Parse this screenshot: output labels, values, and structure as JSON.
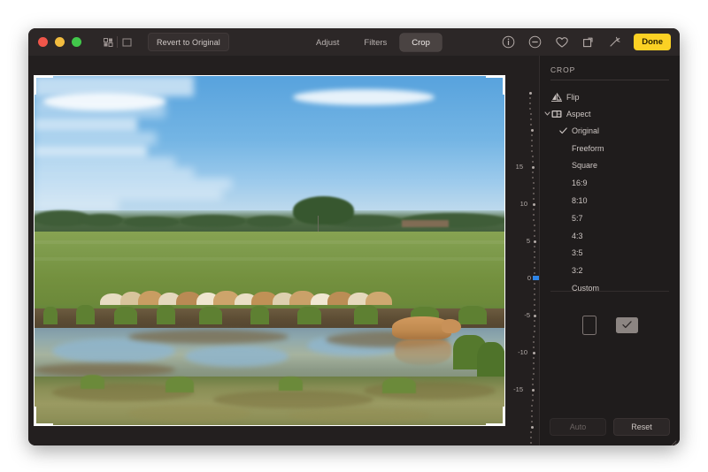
{
  "window": {
    "traffic_lights": [
      {
        "name": "close",
        "color": "#f0564a"
      },
      {
        "name": "minimize",
        "color": "#f2bc3f"
      },
      {
        "name": "zoom",
        "color": "#42c84b"
      }
    ],
    "revert_label": "Revert to Original"
  },
  "toolbar": {
    "segments": [
      {
        "label": "Adjust",
        "active": false
      },
      {
        "label": "Filters",
        "active": false
      },
      {
        "label": "Crop",
        "active": true
      }
    ],
    "icons": [
      {
        "name": "info-icon",
        "glyph": "i"
      },
      {
        "name": "minus-circle-icon",
        "glyph": "-"
      },
      {
        "name": "heart-icon",
        "glyph": "heart"
      },
      {
        "name": "rotate-icon",
        "glyph": "rotate"
      },
      {
        "name": "magic-wand-icon",
        "glyph": "wand"
      }
    ],
    "done_label": "Done"
  },
  "panel": {
    "title": "CROP",
    "flip_label": "Flip",
    "aspect_label": "Aspect",
    "aspect_options": [
      {
        "label": "Original",
        "selected": true
      },
      {
        "label": "Freeform",
        "selected": false
      },
      {
        "label": "Square",
        "selected": false
      },
      {
        "label": "16:9",
        "selected": false
      },
      {
        "label": "8:10",
        "selected": false
      },
      {
        "label": "5:7",
        "selected": false
      },
      {
        "label": "4:3",
        "selected": false
      },
      {
        "label": "3:5",
        "selected": false
      },
      {
        "label": "3:2",
        "selected": false
      },
      {
        "label": "Custom",
        "selected": false
      }
    ],
    "orientation": {
      "portrait_name": "portrait-orientation",
      "landscape_name": "landscape-orientation",
      "selected": "landscape"
    },
    "auto_label": "Auto",
    "auto_enabled": false,
    "reset_label": "Reset"
  },
  "dial": {
    "labels": [
      "15",
      "10",
      "5",
      "0",
      "-5",
      "-10",
      "-15"
    ],
    "current_value": "0",
    "marker_color": "#2e85e8"
  },
  "photo": {
    "alt": "Herd of cream and tan cattle grazing beside a muddy pond in a green summer field under a blue sky with scattered clouds; one cow stands in the water with its reflection.",
    "accent_crop_handle_color": "#ffffff"
  }
}
